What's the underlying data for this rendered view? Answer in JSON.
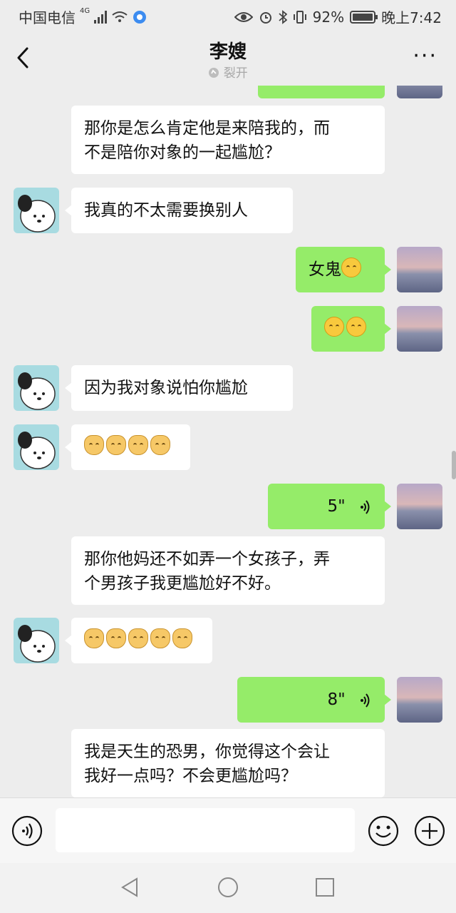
{
  "status_bar": {
    "carrier": "中国电信",
    "network": "4G",
    "battery": "92%",
    "time": "晚上7:42"
  },
  "header": {
    "title": "李嫂",
    "subtitle": "裂开"
  },
  "messages": [
    {
      "side": "left",
      "type": "text",
      "lines": [
        "那你是怎么肯定他是来陪我的，而",
        "不是陪你对象的一起尴尬？"
      ]
    },
    {
      "side": "left",
      "type": "text",
      "lines": [
        "我真的不太需要换别人"
      ]
    },
    {
      "side": "right",
      "type": "text",
      "text": "女鬼",
      "emoji_count": 1
    },
    {
      "side": "right",
      "type": "emoji",
      "emoji_count": 2
    },
    {
      "side": "left",
      "type": "text",
      "lines": [
        "因为我对象说怕你尴尬"
      ]
    },
    {
      "side": "left",
      "type": "emoji",
      "emoji_count": 4
    },
    {
      "side": "right",
      "type": "voice",
      "duration": "5\""
    },
    {
      "side": "left",
      "type": "text",
      "lines": [
        "那你他妈还不如弄一个女孩子，弄",
        "个男孩子我更尴尬好不好。"
      ]
    },
    {
      "side": "left",
      "type": "emoji",
      "emoji_count": 5
    },
    {
      "side": "right",
      "type": "voice",
      "duration": "8\""
    },
    {
      "side": "left",
      "type": "text",
      "lines": [
        "我是天生的恐男，你觉得这个会让",
        "我好一点吗？不会更尴尬吗？"
      ]
    }
  ],
  "input": {
    "placeholder": ""
  },
  "icons": {
    "voice_toggle": "voice-icon",
    "emoji_panel": "smiley-icon",
    "more_panel": "plus-icon",
    "back": "back-arrow-icon",
    "menu": "more-dots-icon"
  }
}
